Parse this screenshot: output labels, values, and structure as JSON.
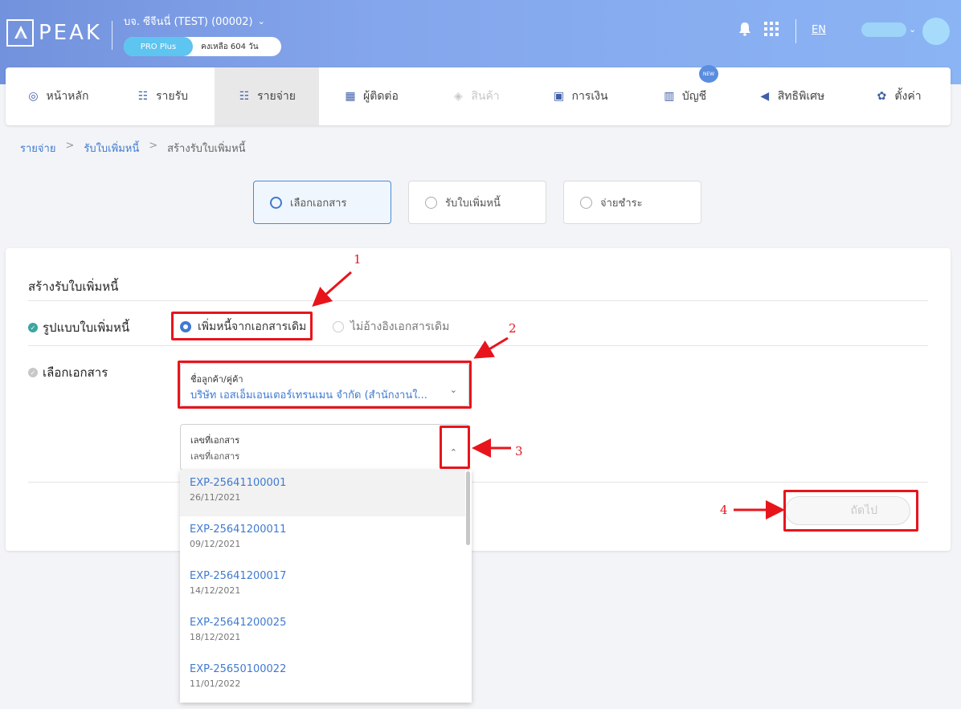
{
  "header": {
    "logo_text": "PEAK",
    "company": "บจ. ซีจีนนี่ (TEST) (00002)",
    "plan": "PRO Plus",
    "days_left": "คงเหลือ 604 วัน",
    "lang": "EN"
  },
  "nav": {
    "items": [
      {
        "label": "หน้าหลัก",
        "icon": "dashboard-icon"
      },
      {
        "label": "รายรับ",
        "icon": "list-icon"
      },
      {
        "label": "รายจ่าย",
        "icon": "list-icon"
      },
      {
        "label": "ผู้ติดต่อ",
        "icon": "contacts-icon"
      },
      {
        "label": "สินค้า",
        "icon": "box-icon"
      },
      {
        "label": "การเงิน",
        "icon": "money-icon"
      },
      {
        "label": "บัญชี",
        "icon": "book-icon"
      },
      {
        "label": "สิทธิพิเศษ",
        "icon": "megaphone-icon"
      },
      {
        "label": "ตั้งค่า",
        "icon": "gear-icon"
      }
    ],
    "new_badge": "NEW"
  },
  "breadcrumb": {
    "level1": "รายจ่าย",
    "level2": "รับใบเพิ่มหนี้",
    "current": "สร้างรับใบเพิ่มหนี้",
    "sep": ">"
  },
  "steps": [
    "เลือกเอกสาร",
    "รับใบเพิ่มหนี้",
    "จ่ายชำระ"
  ],
  "form": {
    "title": "สร้างรับใบเพิ่มหนี้",
    "type_label": "รูปแบบใบเพิ่มหนี้",
    "type_option_1": "เพิ่มหนี้จากเอกสารเดิม",
    "type_option_2": "ไม่อ้างอิงเอกสารเดิม",
    "doc_label": "เลือกเอกสาร",
    "contact_label": "ชื่อลูกค้า/คู่ค้า",
    "contact_value": "บริษัท เอสเอ็มเอนเตอร์เทรนเมน จำกัด (สำนักงานใ...",
    "docno_label": "เลขที่เอกสาร",
    "docno_placeholder": "เลขที่เอกสาร",
    "next_label": "ถัดไป"
  },
  "dropdown": [
    {
      "no": "EXP-25641100001",
      "date": "26/11/2021"
    },
    {
      "no": "EXP-25641200011",
      "date": "09/12/2021"
    },
    {
      "no": "EXP-25641200017",
      "date": "14/12/2021"
    },
    {
      "no": "EXP-25641200025",
      "date": "18/12/2021"
    },
    {
      "no": "EXP-25650100022",
      "date": "11/01/2022"
    }
  ],
  "annotations": [
    "1",
    "2",
    "3",
    "4"
  ],
  "colors": {
    "accent": "#3f7ad0",
    "annotation": "#e8141c",
    "header_start": "#7392dd",
    "header_end": "#8bb4f4"
  }
}
